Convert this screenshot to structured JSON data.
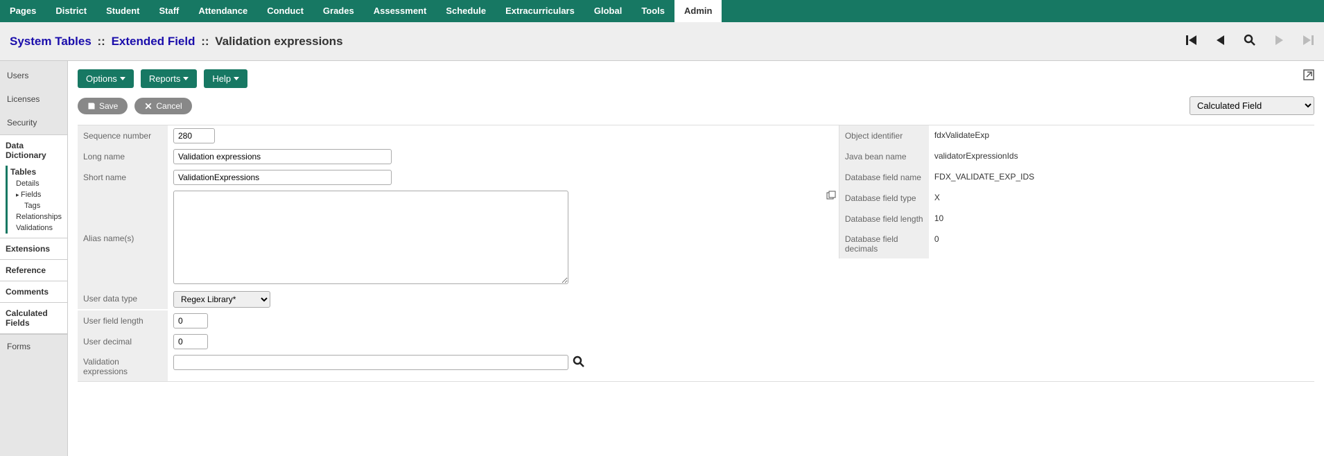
{
  "topnav": {
    "tabs": [
      "Pages",
      "District",
      "Student",
      "Staff",
      "Attendance",
      "Conduct",
      "Grades",
      "Assessment",
      "Schedule",
      "Extracurriculars",
      "Global",
      "Tools",
      "Admin"
    ],
    "active": "Admin"
  },
  "breadcrumb": {
    "parts": [
      {
        "label": "System Tables",
        "link": true
      },
      {
        "label": "Extended Field",
        "link": true
      },
      {
        "label": "Validation expressions",
        "link": false
      }
    ],
    "sep": "::"
  },
  "toolbar": {
    "options": "Options",
    "reports": "Reports",
    "help": "Help"
  },
  "actions": {
    "save": "Save",
    "cancel": "Cancel",
    "mode": {
      "selected": "Calculated Field",
      "options": [
        "Calculated Field"
      ]
    }
  },
  "sidebar": {
    "top": [
      {
        "label": "Users"
      },
      {
        "label": "Licenses"
      },
      {
        "label": "Security"
      }
    ],
    "group": {
      "title": "Data Dictionary",
      "subtitle": "Tables",
      "items": [
        {
          "label": "Details"
        },
        {
          "label": "Fields",
          "selected": true,
          "children": [
            {
              "label": "Tags"
            }
          ]
        },
        {
          "label": "Relationships"
        },
        {
          "label": "Validations"
        }
      ]
    },
    "sections": [
      "Extensions",
      "Reference",
      "Comments",
      "Calculated Fields"
    ],
    "forms": "Forms"
  },
  "form": {
    "left": [
      {
        "key": "seq",
        "label": "Sequence number",
        "value": "280",
        "type": "seq"
      },
      {
        "key": "long",
        "label": "Long name",
        "value": "Validation expressions",
        "type": "wide"
      },
      {
        "key": "short",
        "label": "Short name",
        "value": "ValidationExpressions",
        "type": "wide"
      },
      {
        "key": "alias",
        "label": "Alias name(s)",
        "value": "",
        "type": "alias"
      },
      {
        "key": "udt",
        "label": "User data type",
        "value": "Regex Library*",
        "type": "select",
        "options": [
          "Regex Library*"
        ]
      },
      {
        "key": "ufl",
        "label": "User field length",
        "value": "0",
        "type": "num"
      },
      {
        "key": "ud",
        "label": "User decimal",
        "value": "0",
        "type": "num"
      },
      {
        "key": "ve",
        "label": "Validation expressions",
        "value": "",
        "type": "lookup"
      }
    ],
    "right": [
      {
        "label": "Object identifier",
        "value": "fdxValidateExp"
      },
      {
        "label": "Java bean name",
        "value": "validatorExpressionIds"
      },
      {
        "label": "Database field name",
        "value": "FDX_VALIDATE_EXP_IDS"
      },
      {
        "label": "Database field type",
        "value": "X"
      },
      {
        "label": "Database field length",
        "value": "10"
      },
      {
        "label": "Database field decimals",
        "value": "0"
      }
    ]
  }
}
